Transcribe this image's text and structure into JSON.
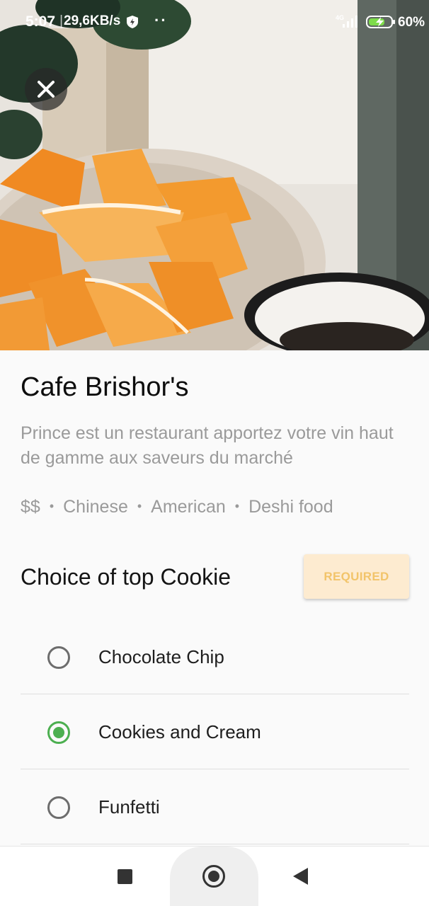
{
  "status_bar": {
    "time": "5:07",
    "separator": "|",
    "speed": "29,6KB/s",
    "dots": "··",
    "network": "4G",
    "battery_percent": "60%"
  },
  "hero": {
    "close_icon": "close-icon"
  },
  "restaurant": {
    "name": "Cafe Brishor's",
    "description": "Prince est un restaurant apportez votre vin haut de gamme aux saveurs du marché",
    "tags": [
      "$$",
      "Chinese",
      "American",
      "Deshi food"
    ],
    "tag_separator": "•"
  },
  "choice": {
    "title": "Choice of top Cookie",
    "required_label": "REQUIRED",
    "options": [
      {
        "label": "Chocolate Chip",
        "selected": false
      },
      {
        "label": "Cookies and Cream",
        "selected": true
      },
      {
        "label": "Funfetti",
        "selected": false
      }
    ]
  },
  "nav": {
    "recent_icon": "square-icon",
    "home_icon": "circle-icon",
    "back_icon": "triangle-back-icon"
  },
  "colors": {
    "accent_green": "#4caf50",
    "required_bg": "#fdebd0",
    "required_text": "#f2c46a",
    "muted_text": "#9a9a9a"
  }
}
